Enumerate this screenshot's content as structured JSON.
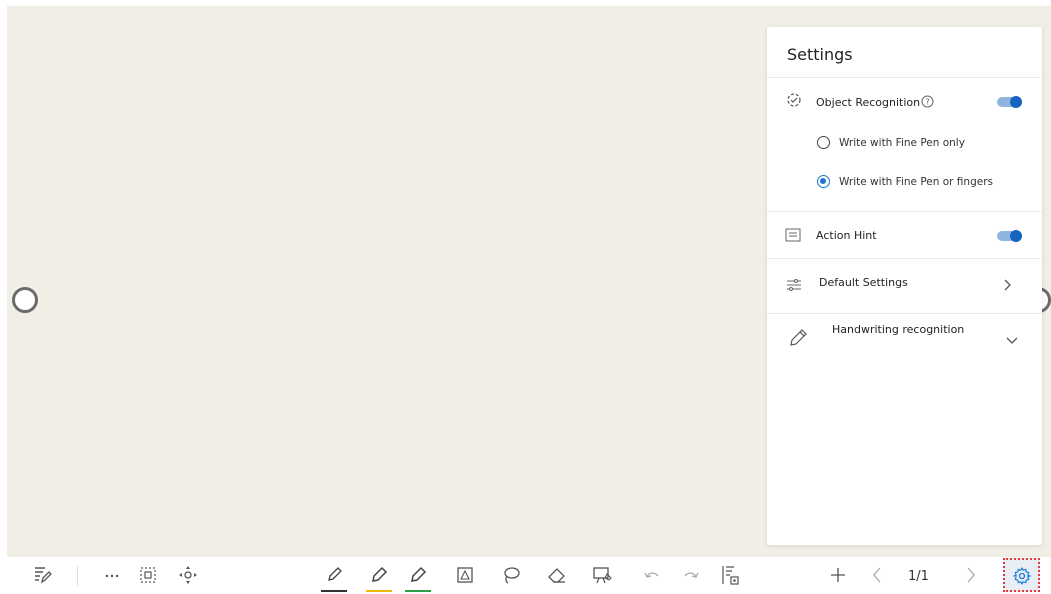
{
  "settings_panel": {
    "title": "Settings",
    "object_recognition": {
      "label": "Object Recognition",
      "enabled": true,
      "options": [
        {
          "label": "Write with Fine Pen only",
          "selected": false
        },
        {
          "label": "Write with Fine Pen or fingers",
          "selected": true
        }
      ]
    },
    "action_hint": {
      "label": "Action Hint",
      "enabled": true
    },
    "default_settings": {
      "label": "Default Settings"
    },
    "handwriting_recognition": {
      "label": "Handwriting recognition"
    }
  },
  "toolbar": {
    "page_indicator": "1/1",
    "pen_colors": [
      "#333333",
      "#f2b705",
      "#2e9e44"
    ],
    "accent_color": "#1976d2"
  },
  "colors": {
    "canvas": "#f1eee6",
    "toggle_on": "#1565c0",
    "highlight_border": "#e53935"
  }
}
